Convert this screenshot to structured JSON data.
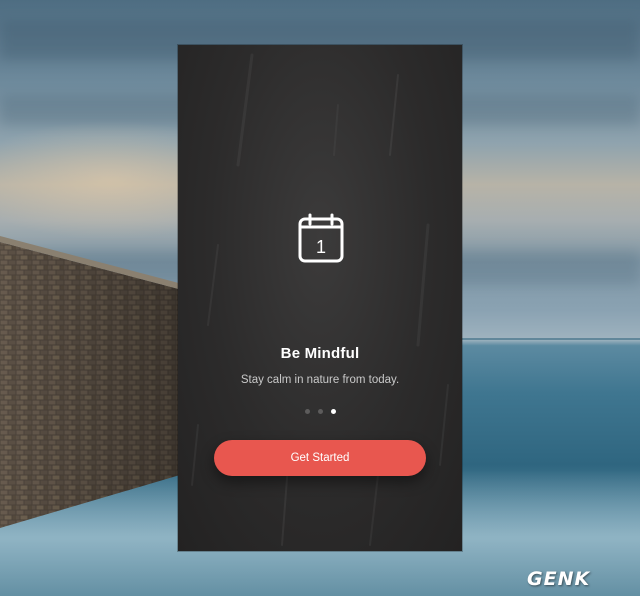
{
  "onboarding": {
    "icon": "calendar-icon",
    "calendar_day": "1",
    "title": "Be Mindful",
    "subtitle": "Stay calm in nature from today.",
    "pagination": {
      "total": 3,
      "active_index": 2
    },
    "cta_label": "Get Started"
  },
  "watermark": "GENK",
  "colors": {
    "phone_background": "#2c2b2b",
    "accent": "#e8574f",
    "dot_active": "#ffffff",
    "dot_inactive": "#5d5c5c"
  }
}
